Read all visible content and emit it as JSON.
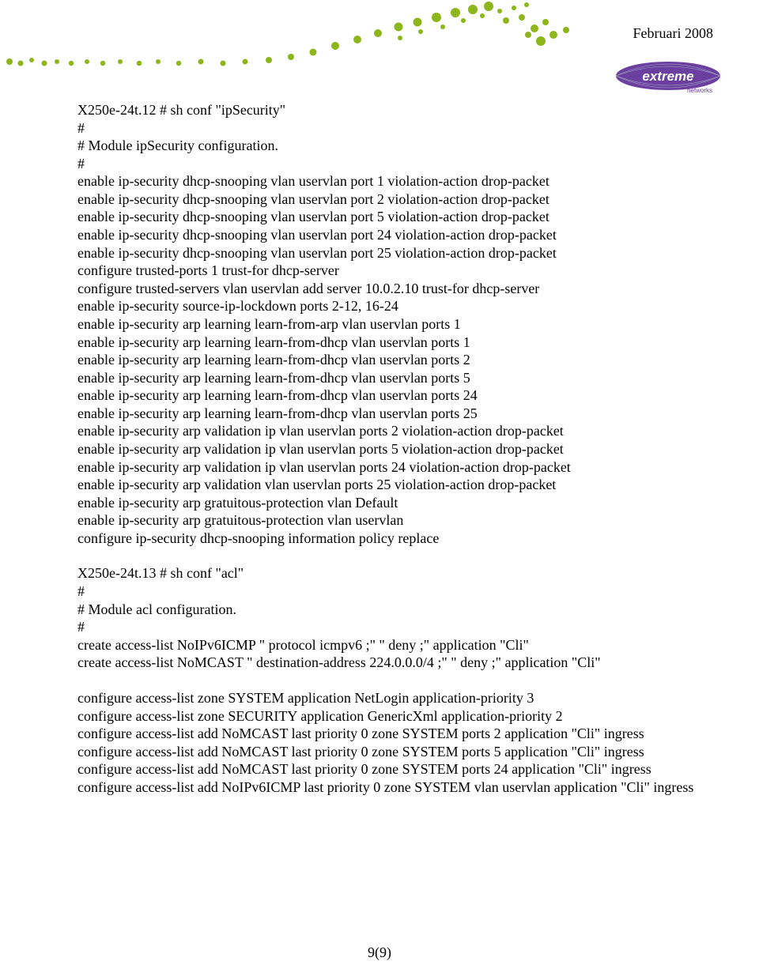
{
  "header": {
    "date": "Februari 2008",
    "logo_alt": "extreme networks"
  },
  "blocks": [
    {
      "lines": [
        "X250e-24t.12 # sh conf \"ipSecurity\"",
        "#",
        "# Module ipSecurity configuration.",
        "#",
        "enable ip-security dhcp-snooping vlan uservlan port 1 violation-action drop-packet",
        "enable ip-security dhcp-snooping vlan uservlan port 2 violation-action drop-packet",
        "enable ip-security dhcp-snooping vlan uservlan port 5 violation-action drop-packet",
        "enable ip-security dhcp-snooping vlan uservlan port 24 violation-action drop-packet",
        "enable ip-security dhcp-snooping vlan uservlan port 25 violation-action drop-packet",
        "configure trusted-ports 1 trust-for dhcp-server",
        "configure trusted-servers vlan uservlan add server 10.0.2.10 trust-for dhcp-server",
        "enable ip-security source-ip-lockdown ports 2-12, 16-24",
        "enable ip-security arp learning learn-from-arp vlan uservlan ports 1",
        "enable ip-security arp learning learn-from-dhcp vlan uservlan ports 1",
        "enable ip-security arp learning learn-from-dhcp vlan uservlan ports 2",
        "enable ip-security arp learning learn-from-dhcp vlan uservlan ports 5",
        "enable ip-security arp learning learn-from-dhcp vlan uservlan ports 24",
        "enable ip-security arp learning learn-from-dhcp vlan uservlan ports 25",
        "enable ip-security arp validation ip vlan uservlan ports 2 violation-action drop-packet",
        "enable ip-security arp validation ip vlan uservlan ports 5 violation-action drop-packet",
        "enable ip-security arp validation ip vlan uservlan ports 24 violation-action drop-packet",
        "enable ip-security arp validation vlan uservlan ports 25 violation-action drop-packet",
        "enable ip-security arp gratuitous-protection vlan Default",
        "enable ip-security arp gratuitous-protection vlan uservlan",
        "configure ip-security dhcp-snooping information policy replace"
      ]
    },
    {
      "lines": [
        "X250e-24t.13 # sh conf \"acl\"",
        "#",
        "# Module acl configuration.",
        "#",
        "create access-list NoIPv6ICMP \" protocol icmpv6 ;\" \" deny  ;\" application \"Cli\"",
        "create access-list NoMCAST \" destination-address 224.0.0.0/4 ;\" \" deny  ;\" application \"Cli\""
      ]
    },
    {
      "lines": [
        "configure access-list zone SYSTEM application NetLogin application-priority 3",
        "configure access-list zone SECURITY application GenericXml application-priority 2",
        "configure access-list add NoMCAST last priority 0 zone SYSTEM ports 2 application \"Cli\" ingress",
        "configure access-list add NoMCAST last priority 0 zone SYSTEM ports 5 application \"Cli\" ingress",
        "configure access-list add NoMCAST last priority 0 zone SYSTEM ports 24 application \"Cli\" ingress",
        "configure access-list add NoIPv6ICMP last priority 0 zone SYSTEM vlan uservlan application \"Cli\" ingress"
      ]
    }
  ],
  "footer": {
    "page": "9(9)"
  }
}
